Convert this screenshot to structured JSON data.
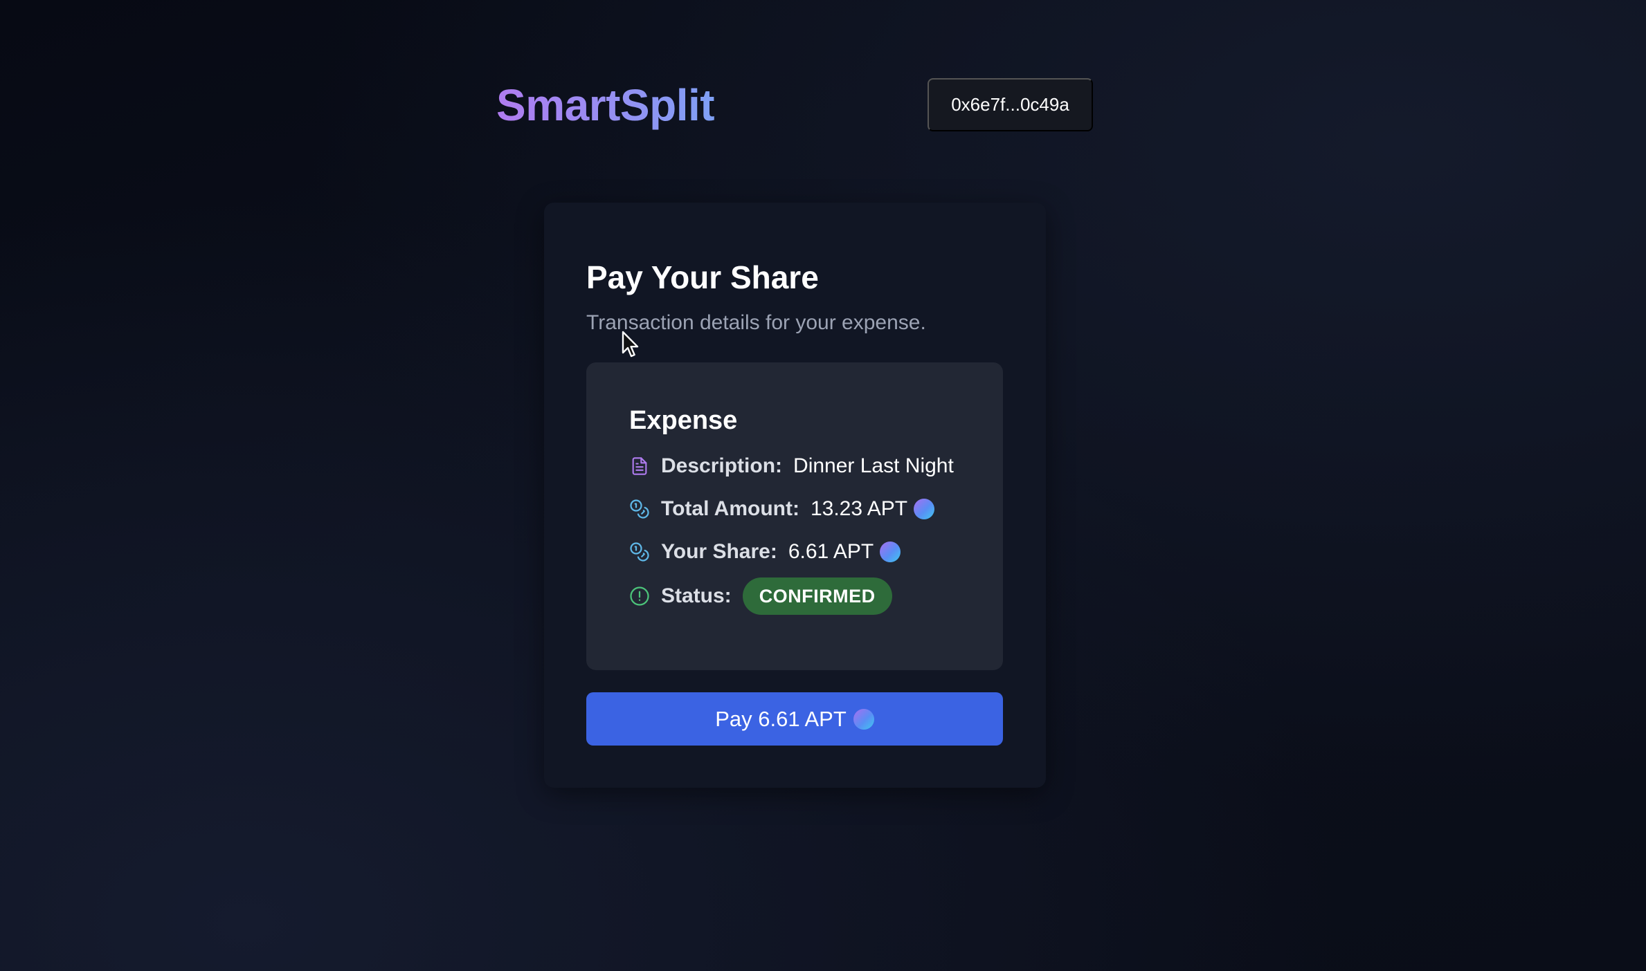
{
  "header": {
    "brand": "SmartSplit",
    "wallet_address": "0x6e7f...0c49a"
  },
  "card": {
    "title": "Pay Your Share",
    "subtitle": "Transaction details for your expense."
  },
  "expense": {
    "heading": "Expense",
    "rows": [
      {
        "label": "Description:",
        "value": "Dinner Last Night",
        "icon": "document-icon",
        "icon_color": "#b07cf0"
      },
      {
        "label": "Total Amount:",
        "value": "13.23 APT",
        "icon": "coins-icon",
        "icon_color": "#5fb8e8"
      },
      {
        "label": "Your Share:",
        "value": "6.61 APT",
        "icon": "coins-icon",
        "icon_color": "#5fb8e8"
      },
      {
        "label": "Status:",
        "value": "CONFIRMED",
        "icon": "alert-circle-icon",
        "icon_color": "#4cc47a"
      }
    ]
  },
  "actions": {
    "pay_label": "Pay 6.61 APT"
  },
  "colors": {
    "accent_blue": "#3b63e3",
    "status_green": "#2e6b3a",
    "brand_gradient_start": "#b07cf0",
    "brand_gradient_end": "#7fa0f5"
  }
}
